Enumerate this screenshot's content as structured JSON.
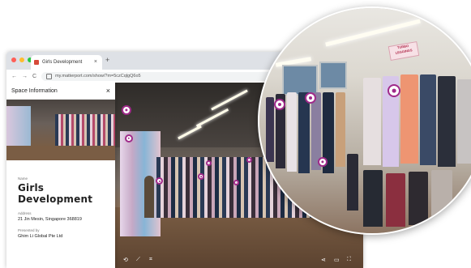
{
  "browser": {
    "tab_title": "Girls Development",
    "tab_close": "×",
    "new_tab": "+",
    "nav_back": "←",
    "nav_forward": "→",
    "nav_reload": "C",
    "url": "my.matterport.com/show/?m=5czCqlgQ6o5"
  },
  "panel": {
    "header": "Space Information",
    "close": "×",
    "name_label": "Name",
    "name": "Girls Development",
    "address_label": "Address",
    "address": "21 Jin Mesin, Singapore 368819",
    "presented_label": "Presented by",
    "presented_by": "Ghim Li Global Pte Ltd"
  },
  "zoom": {
    "sign_text": "TURBO LEGGINGS"
  },
  "colors": {
    "hotspot": "#a02a8a",
    "traffic_red": "#ff5f57",
    "traffic_yellow": "#febc2e",
    "traffic_green": "#28c840"
  },
  "icons": [
    "share-icon",
    "cube-icon",
    "fullscreen-icon",
    "rotate-icon",
    "measure-icon",
    "floorplan-icon"
  ]
}
